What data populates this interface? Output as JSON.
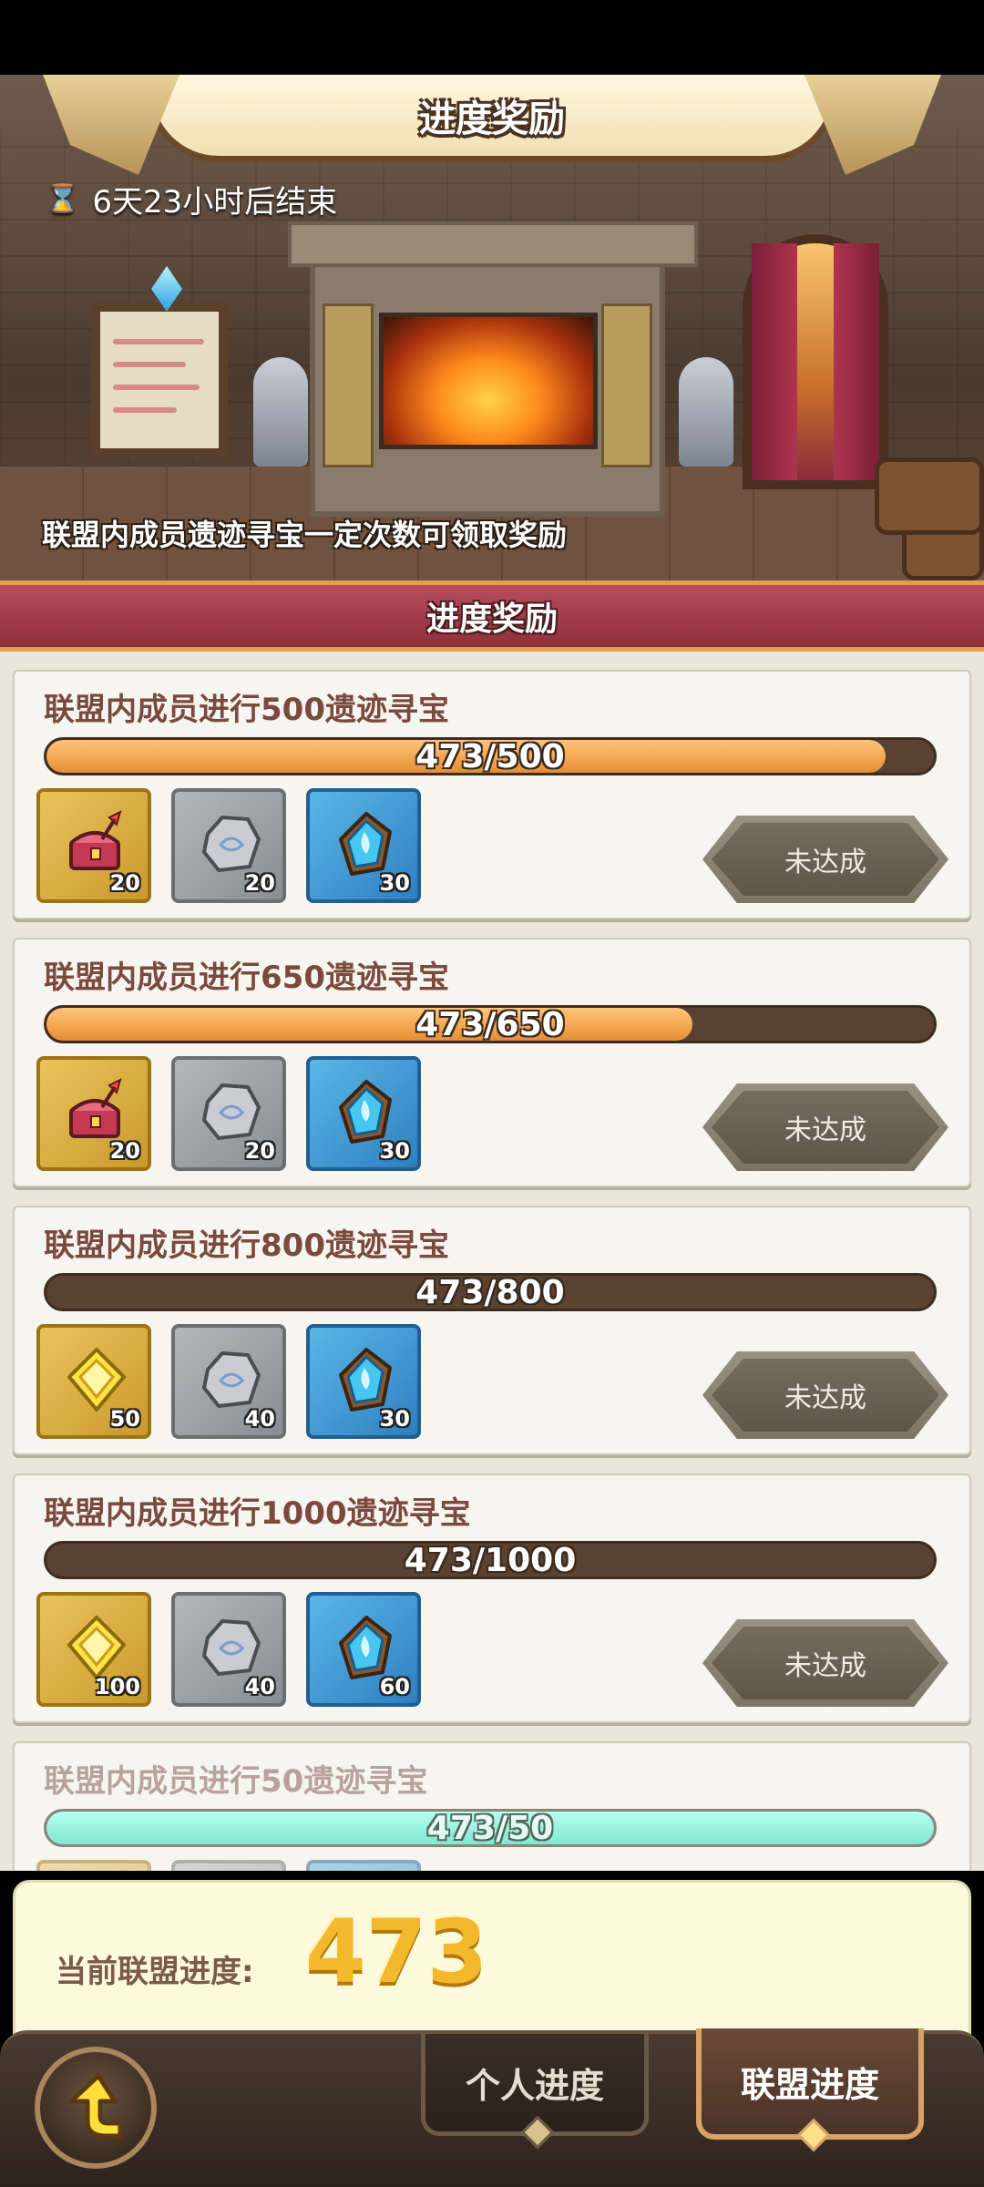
{
  "banner": {
    "title": "进度奖励",
    "timer": "6天23小时后结束",
    "description": "联盟内成员遗迹寻宝一定次数可领取奖励"
  },
  "section": {
    "title": "进度奖励"
  },
  "tasks": [
    {
      "title": "联盟内成员进行500遗迹寻宝",
      "progress_text": "473/500",
      "progress": 0.946,
      "rewards": [
        {
          "icon": "red-chest-icon",
          "frame": "gold",
          "count": "20"
        },
        {
          "icon": "gray-stone-icon",
          "frame": "gray",
          "count": "20"
        },
        {
          "icon": "blue-crystal-icon",
          "frame": "blue",
          "count": "30"
        }
      ],
      "status": "未达成"
    },
    {
      "title": "联盟内成员进行650遗迹寻宝",
      "progress_text": "473/650",
      "progress": 0.728,
      "rewards": [
        {
          "icon": "red-chest-icon",
          "frame": "gold",
          "count": "20"
        },
        {
          "icon": "gray-stone-icon",
          "frame": "gray",
          "count": "20"
        },
        {
          "icon": "blue-crystal-icon",
          "frame": "blue",
          "count": "30"
        }
      ],
      "status": "未达成"
    },
    {
      "title": "联盟内成员进行800遗迹寻宝",
      "progress_text": "473/800",
      "progress": 0.0,
      "rewards": [
        {
          "icon": "gold-gem-icon",
          "frame": "gold",
          "count": "50"
        },
        {
          "icon": "gray-stone-icon",
          "frame": "gray",
          "count": "40"
        },
        {
          "icon": "blue-crystal-icon",
          "frame": "blue",
          "count": "30"
        }
      ],
      "status": "未达成"
    },
    {
      "title": "联盟内成员进行1000遗迹寻宝",
      "progress_text": "473/1000",
      "progress": 0.0,
      "rewards": [
        {
          "icon": "gold-gem-icon",
          "frame": "gold",
          "count": "100"
        },
        {
          "icon": "gray-stone-icon",
          "frame": "gray",
          "count": "40"
        },
        {
          "icon": "blue-crystal-icon",
          "frame": "blue",
          "count": "60"
        }
      ],
      "status": "未达成"
    },
    {
      "title": "联盟内成员进行50遗迹寻宝",
      "progress_text": "473/50",
      "progress": 1.0,
      "faded": true,
      "rewards": [
        {
          "icon": "gold-gem-icon",
          "frame": "gold",
          "count": ""
        },
        {
          "icon": "gray-stone-icon",
          "frame": "gray",
          "count": ""
        },
        {
          "icon": "blue-crystal-icon",
          "frame": "blue",
          "count": ""
        }
      ],
      "status": ""
    }
  ],
  "summary": {
    "label": "当前联盟进度:",
    "value": "473"
  },
  "footer": {
    "tab_personal": "个人进度",
    "tab_alliance": "联盟进度",
    "active_tab": "联盟进度"
  },
  "colors": {
    "progress_fill": "#f2a44e",
    "progress_track": "#5a4232",
    "section_header": "#8e2f3c",
    "summary_value": "#f4b92b"
  }
}
